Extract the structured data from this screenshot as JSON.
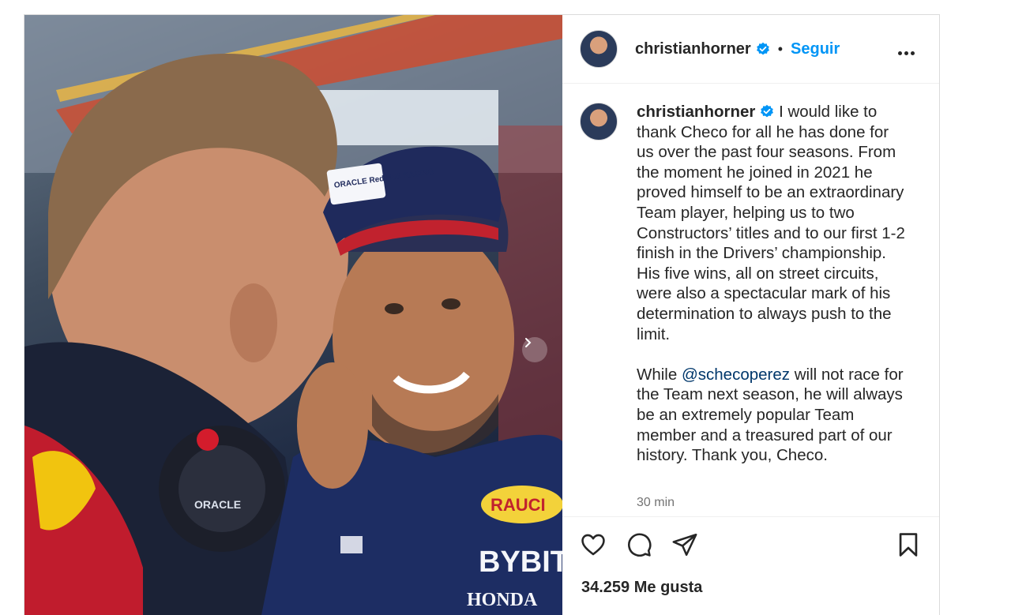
{
  "post": {
    "username": "christianhorner",
    "follow_label": "Seguir",
    "separator": "•",
    "caption_p1": "I would like to thank Checo for all he has done for us over the past four seasons. From the moment he joined in 2021 he proved himself to be an extraordinary Team player, helping us to two Constructors’ titles and to our first 1-2 finish in the Drivers’ championship. His five wins, all on street circuits, were also a spectacular mark of his determination to always push to the limit.",
    "caption_p2_before": "While ",
    "mention": "@schecoperez",
    "caption_p2_after": " will not race for the Team next season, he will always be an extremely popular Team member and a treasured part of our history. Thank you, Checo.",
    "time": "30 min",
    "likes": "34.259 Me gusta"
  },
  "photo": {
    "cap_text": "ORACLE Red Bull RACING",
    "suit_sponsors": [
      "RAUCI",
      "BYBIT",
      "HONDA"
    ]
  },
  "icons": [
    "verified-badge-icon",
    "more-options-icon",
    "heart-icon",
    "comment-icon",
    "share-icon",
    "bookmark-icon",
    "chevron-right-icon"
  ],
  "colors": {
    "accent": "#0095f6",
    "mention": "#00376b",
    "verified": "#0095f6"
  }
}
